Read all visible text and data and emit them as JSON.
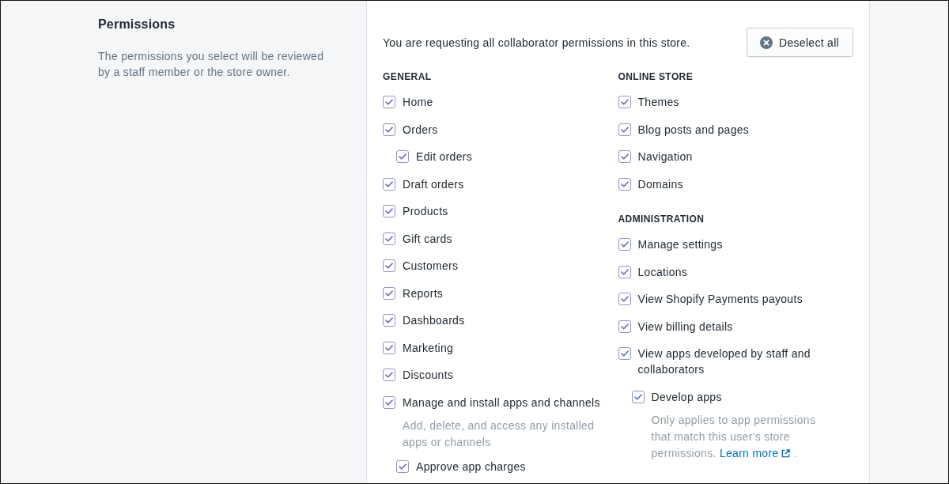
{
  "section": {
    "title": "Permissions",
    "description": "The permissions you select will be reviewed by a staff member or the store owner."
  },
  "card": {
    "notice": "You are requesting all collaborator permissions in this store.",
    "deselect_button": {
      "label": "Deselect all"
    }
  },
  "columns": [
    {
      "groups": [
        {
          "heading": "GENERAL",
          "items": [
            {
              "label": "Home",
              "checked": true
            },
            {
              "label": "Orders",
              "checked": true,
              "children": [
                {
                  "label": "Edit orders",
                  "checked": true
                }
              ]
            },
            {
              "label": "Draft orders",
              "checked": true
            },
            {
              "label": "Products",
              "checked": true
            },
            {
              "label": "Gift cards",
              "checked": true
            },
            {
              "label": "Customers",
              "checked": true
            },
            {
              "label": "Reports",
              "checked": true
            },
            {
              "label": "Dashboards",
              "checked": true
            },
            {
              "label": "Marketing",
              "checked": true
            },
            {
              "label": "Discounts",
              "checked": true
            },
            {
              "label": "Manage and install apps and channels",
              "checked": true,
              "help": {
                "text": "Add, delete, and access any installed apps or channels"
              },
              "children": [
                {
                  "label": "Approve app charges",
                  "checked": true
                }
              ]
            }
          ]
        }
      ]
    },
    {
      "groups": [
        {
          "heading": "ONLINE STORE",
          "items": [
            {
              "label": "Themes",
              "checked": true
            },
            {
              "label": "Blog posts and pages",
              "checked": true
            },
            {
              "label": "Navigation",
              "checked": true
            },
            {
              "label": "Domains",
              "checked": true
            }
          ]
        },
        {
          "heading": "ADMINISTRATION",
          "items": [
            {
              "label": "Manage settings",
              "checked": true
            },
            {
              "label": "Locations",
              "checked": true
            },
            {
              "label": "View Shopify Payments payouts",
              "checked": true
            },
            {
              "label": "View billing details",
              "checked": true
            },
            {
              "label": "View apps developed by staff and collaborators",
              "checked": true,
              "children": [
                {
                  "label": "Develop apps",
                  "checked": true,
                  "help": {
                    "text": "Only applies to app permissions that match this user's store permissions.",
                    "link": "Learn more",
                    "tail": "."
                  }
                }
              ]
            }
          ]
        }
      ]
    }
  ]
}
